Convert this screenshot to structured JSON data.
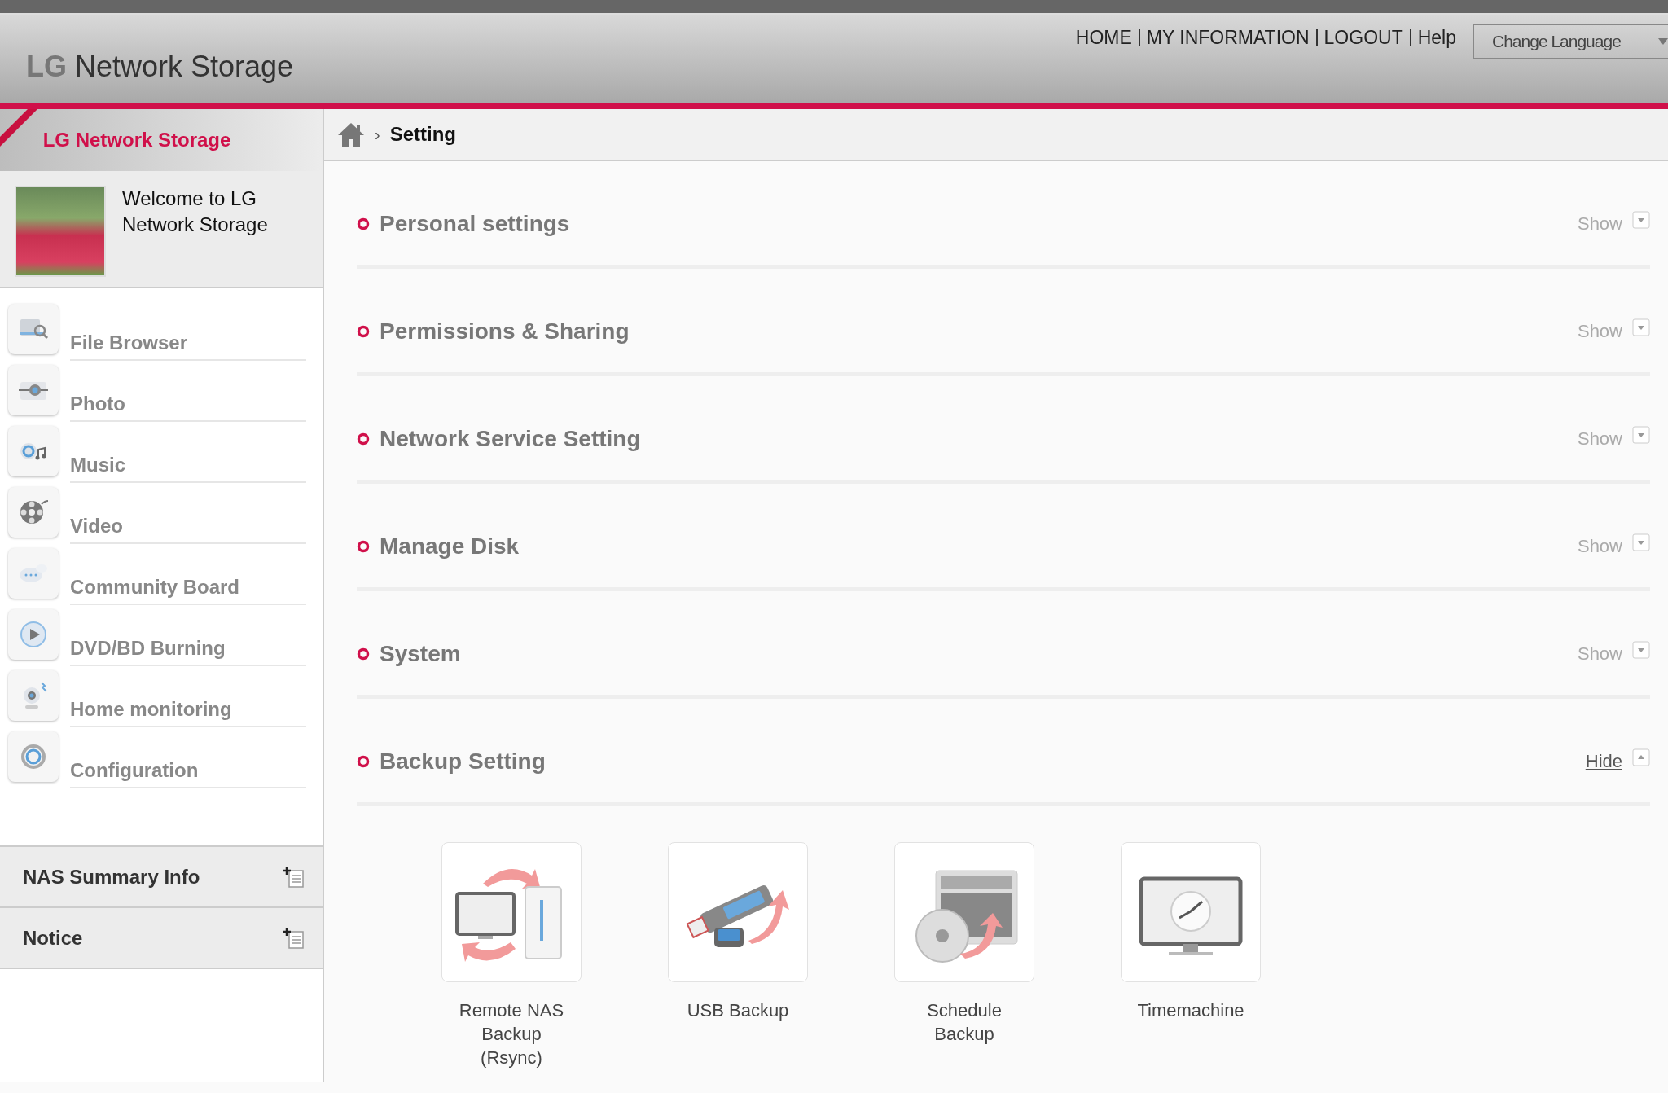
{
  "header": {
    "logo_mark": "LG",
    "logo_text": "Network Storage",
    "nav": [
      "HOME",
      "MY INFORMATION",
      "LOGOUT",
      "Help"
    ],
    "language_select": {
      "placeholder": "Change Language"
    }
  },
  "sidebar": {
    "title": "LG Network Storage",
    "welcome": "Welcome to LG Network Storage",
    "items": [
      {
        "label": "File Browser",
        "kind": "files"
      },
      {
        "label": "Photo",
        "kind": "photo"
      },
      {
        "label": "Music",
        "kind": "music"
      },
      {
        "label": "Video",
        "kind": "video"
      },
      {
        "label": "Community Board",
        "kind": "chat"
      },
      {
        "label": "DVD/BD Burning",
        "kind": "disc"
      },
      {
        "label": "Home monitoring",
        "kind": "camera"
      },
      {
        "label": "Configuration",
        "kind": "gear"
      }
    ],
    "panels": [
      {
        "label": "NAS Summary Info"
      },
      {
        "label": "Notice"
      }
    ]
  },
  "breadcrumb": {
    "separator": "›",
    "current": "Setting"
  },
  "sections": [
    {
      "title": "Personal settings",
      "toggle": "Show",
      "expanded": false
    },
    {
      "title": "Permissions & Sharing",
      "toggle": "Show",
      "expanded": false
    },
    {
      "title": "Network Service Setting",
      "toggle": "Show",
      "expanded": false
    },
    {
      "title": "Manage Disk",
      "toggle": "Show",
      "expanded": false
    },
    {
      "title": "System",
      "toggle": "Show",
      "expanded": false
    },
    {
      "title": "Backup Setting",
      "toggle": "Hide",
      "expanded": true,
      "items": [
        {
          "label": "Remote NAS Backup (Rsync)",
          "kind": "remote"
        },
        {
          "label": "USB Backup",
          "kind": "usb"
        },
        {
          "label": "Schedule Backup",
          "kind": "schedule"
        },
        {
          "label": "Timemachine",
          "kind": "time"
        }
      ]
    }
  ]
}
